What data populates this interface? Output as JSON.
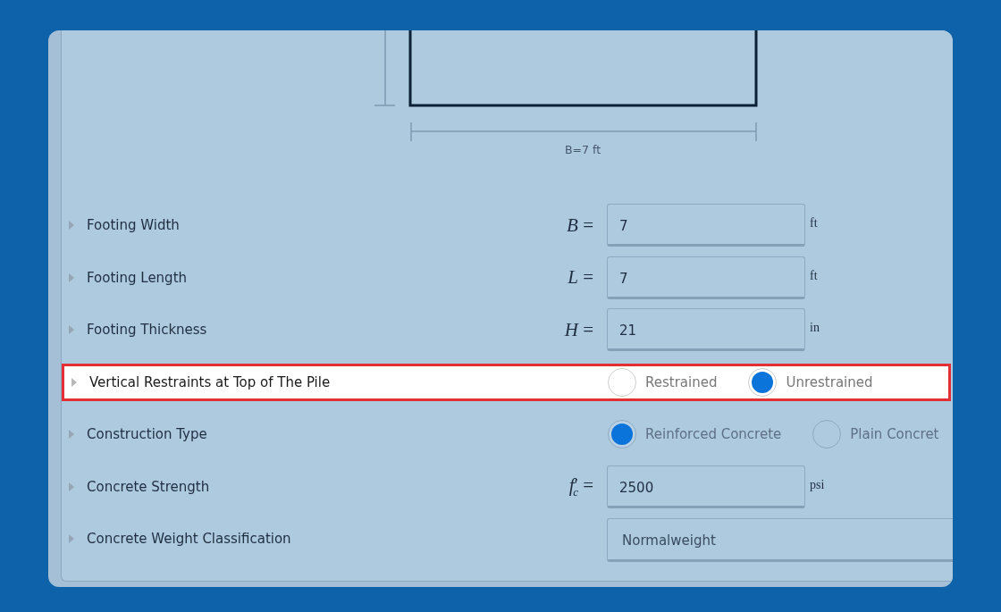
{
  "diagram": {
    "dimension_label": "B=7 ft"
  },
  "parameters": [
    {
      "kind": "input",
      "label": "Footing Width",
      "symbol": "*B* =",
      "value": "7",
      "unit": "ft",
      "highlighted": false
    },
    {
      "kind": "input",
      "label": "Footing Length",
      "symbol": "*L* =",
      "value": "7",
      "unit": "ft",
      "highlighted": false
    },
    {
      "kind": "input",
      "label": "Footing Thickness",
      "symbol": "*H* =",
      "value": "21",
      "unit": "in",
      "highlighted": false
    },
    {
      "kind": "radio",
      "label": "Vertical Restraints at Top of The Pile",
      "highlighted": true,
      "options": [
        {
          "label": "Restrained",
          "selected": false
        },
        {
          "label": "Unrestrained",
          "selected": true
        }
      ]
    },
    {
      "kind": "radio",
      "label": "Construction Type",
      "highlighted": false,
      "options": [
        {
          "label": "Reinforced Concrete",
          "selected": true
        },
        {
          "label": "Plain Concret",
          "selected": false
        }
      ]
    },
    {
      "kind": "input",
      "label": "Concrete Strength",
      "symbol": "*f*′$_{c}$ =",
      "value": "2500",
      "unit": "psi",
      "highlighted": false
    },
    {
      "kind": "select",
      "label": "Concrete Weight Classification",
      "value": "Normalweight",
      "highlighted": false
    }
  ]
}
